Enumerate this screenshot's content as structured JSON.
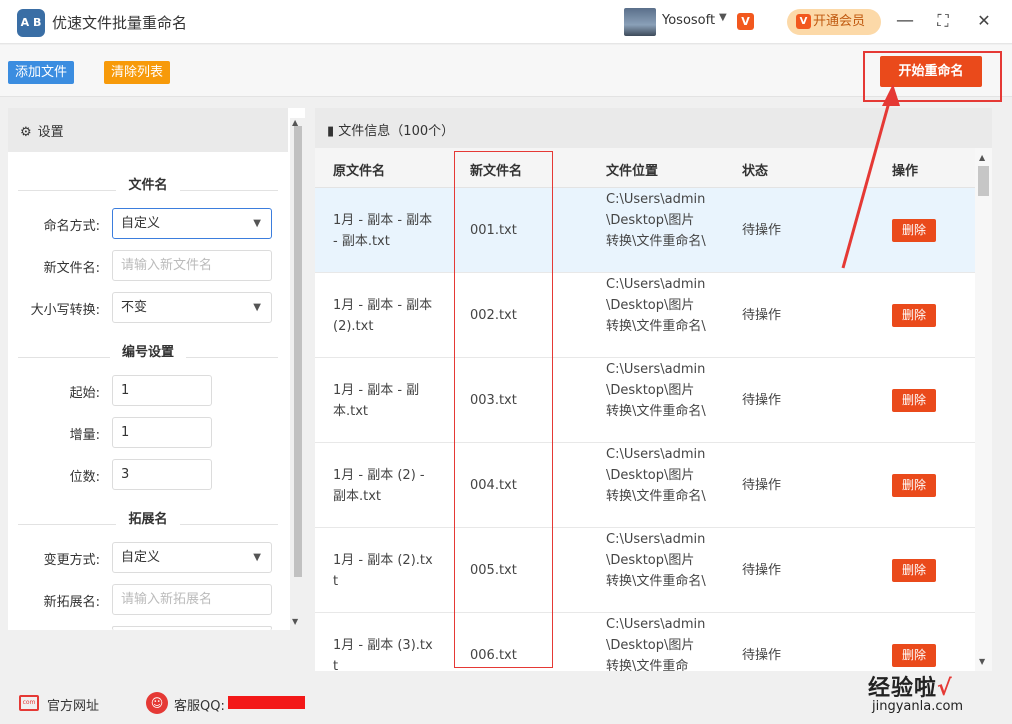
{
  "app": {
    "logo_text": "A B",
    "title": "优速文件批量重命名"
  },
  "header": {
    "user_name": "Yososoft",
    "vip_label": "开通会员",
    "vip_icon": "V"
  },
  "window": {
    "minimize": "—",
    "maximize": "⛶",
    "close": "✕"
  },
  "toolbar": {
    "add_files": "添加文件",
    "clear_list": "清除列表",
    "start_rename": "开始重命名"
  },
  "settings": {
    "header": "设置",
    "filename_section": "文件名",
    "naming_mode_label": "命名方式:",
    "naming_mode_value": "自定义",
    "new_name_label": "新文件名:",
    "new_name_placeholder": "请输入新文件名",
    "case_label": "大小写转换:",
    "case_value": "不变",
    "numbering_section": "编号设置",
    "start_label": "起始:",
    "start_value": "1",
    "increment_label": "增量:",
    "increment_value": "1",
    "digits_label": "位数:",
    "digits_value": "3",
    "extension_section": "拓展名",
    "ext_mode_label": "变更方式:",
    "ext_mode_value": "自定义",
    "new_ext_label": "新拓展名:",
    "new_ext_placeholder": "请输入新拓展名"
  },
  "file_panel": {
    "header": "文件信息（100个）",
    "columns": {
      "original": "原文件名",
      "new": "新文件名",
      "location": "文件位置",
      "status": "状态",
      "action": "操作"
    },
    "rows": [
      {
        "original": "1月 - 副本 - 副本 - 副本.txt",
        "new": "001.txt",
        "location": "C:\\Users\\admin\\Desktop\\图片转换\\文件重命名\\",
        "status": "待操作",
        "action": "删除"
      },
      {
        "original": "1月 - 副本 - 副本 (2).txt",
        "new": "002.txt",
        "location": "C:\\Users\\admin\\Desktop\\图片转换\\文件重命名\\",
        "status": "待操作",
        "action": "删除"
      },
      {
        "original": "1月 - 副本 - 副本.txt",
        "new": "003.txt",
        "location": "C:\\Users\\admin\\Desktop\\图片转换\\文件重命名\\",
        "status": "待操作",
        "action": "删除"
      },
      {
        "original": "1月 - 副本 (2) - 副本.txt",
        "new": "004.txt",
        "location": "C:\\Users\\admin\\Desktop\\图片转换\\文件重命名\\",
        "status": "待操作",
        "action": "删除"
      },
      {
        "original": "1月 - 副本 (2).txt",
        "new": "005.txt",
        "location": "C:\\Users\\admin\\Desktop\\图片转换\\文件重命名\\",
        "status": "待操作",
        "action": "删除"
      },
      {
        "original": "1月 - 副本 (3).txt",
        "new": "006.txt",
        "location": "C:\\Users\\admin\\Desktop\\图片转换\\文件重命",
        "status": "待操作",
        "action": "删除"
      }
    ]
  },
  "footer": {
    "website": "官方网址",
    "support": "客服QQ:"
  },
  "watermark": {
    "line1": "经验啦",
    "tick": "√",
    "line2": "jingyanla.com"
  },
  "colors": {
    "accent_blue": "#3b8de0",
    "accent_orange": "#f79a0a",
    "primary_red": "#ea4a1b",
    "highlight": "#e53935"
  }
}
